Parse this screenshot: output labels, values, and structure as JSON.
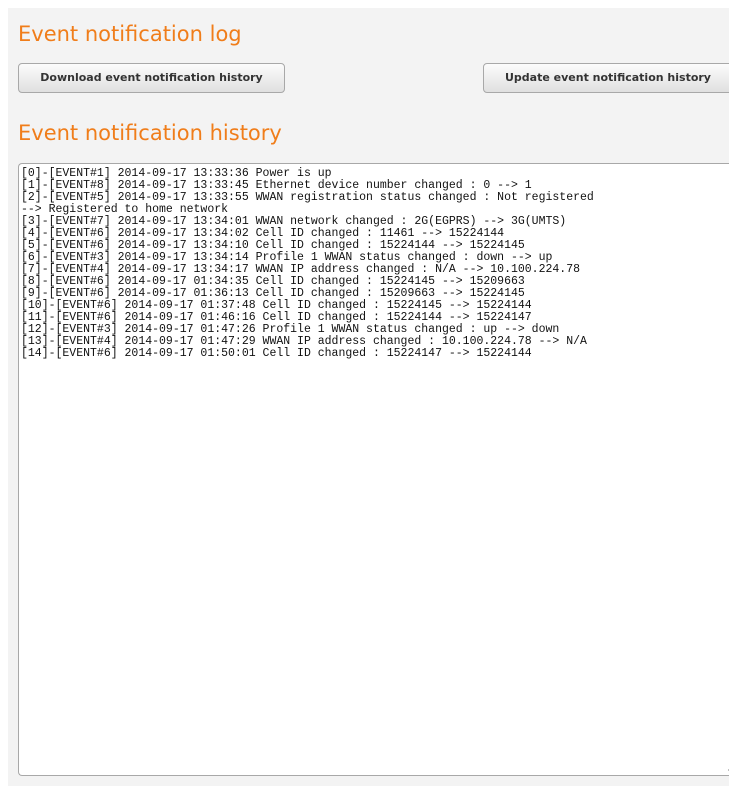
{
  "log_section": {
    "title": "Event notification log",
    "download_label": "Download event notification history",
    "update_label": "Update event notification history"
  },
  "history_section": {
    "title": "Event notification history",
    "lines": [
      "[0]-[EVENT#1] 2014-09-17 13:33:36 Power is up",
      "[1]-[EVENT#8] 2014-09-17 13:33:45 Ethernet device number changed : 0 --> 1",
      "[2]-[EVENT#5] 2014-09-17 13:33:55 WWAN registration status changed : Not registered",
      "--> Registered to home network",
      "[3]-[EVENT#7] 2014-09-17 13:34:01 WWAN network changed : 2G(EGPRS) --> 3G(UMTS)",
      "[4]-[EVENT#6] 2014-09-17 13:34:02 Cell ID changed : 11461 --> 15224144",
      "[5]-[EVENT#6] 2014-09-17 13:34:10 Cell ID changed : 15224144 --> 15224145",
      "[6]-[EVENT#3] 2014-09-17 13:34:14 Profile 1 WWAN status changed : down --> up",
      "[7]-[EVENT#4] 2014-09-17 13:34:17 WWAN IP address changed : N/A --> 10.100.224.78",
      "[8]-[EVENT#6] 2014-09-17 01:34:35 Cell ID changed : 15224145 --> 15209663",
      "[9]-[EVENT#6] 2014-09-17 01:36:13 Cell ID changed : 15209663 --> 15224145",
      "[10]-[EVENT#6] 2014-09-17 01:37:48 Cell ID changed : 15224145 --> 15224144",
      "[11]-[EVENT#6] 2014-09-17 01:46:16 Cell ID changed : 15224144 --> 15224147",
      "[12]-[EVENT#3] 2014-09-17 01:47:26 Profile 1 WWAN status changed : up --> down",
      "[13]-[EVENT#4] 2014-09-17 01:47:29 WWAN IP address changed : 10.100.224.78 --> N/A",
      "[14]-[EVENT#6] 2014-09-17 01:50:01 Cell ID changed : 15224147 --> 15224144"
    ]
  }
}
